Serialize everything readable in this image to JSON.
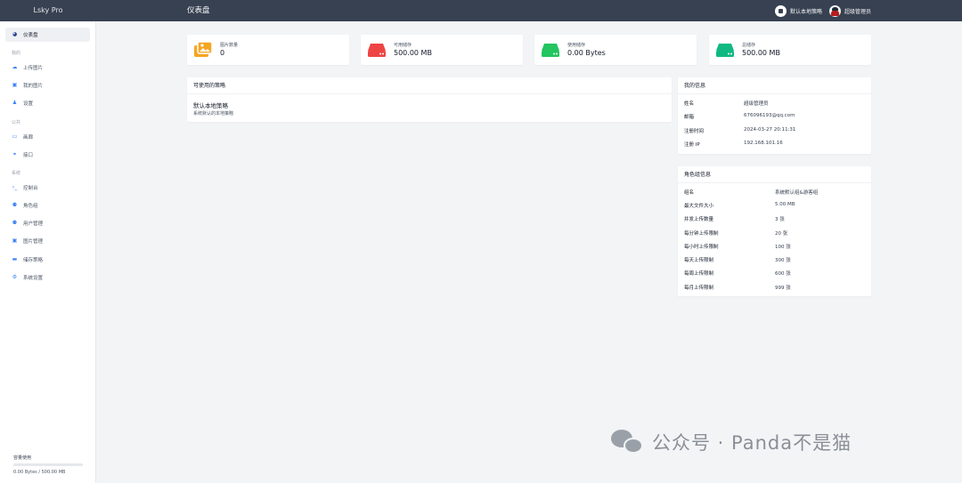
{
  "app": {
    "brand": "Lsky Pro",
    "page_title": "仪表盘"
  },
  "topbar": {
    "strategy_button": "默认本地策略",
    "user_button": "超级管理员"
  },
  "sidebar": {
    "items": [
      {
        "label": "仪表盘",
        "icon": "dashboard-icon"
      },
      {
        "label": "上传图片",
        "icon": "cloud-upload-icon"
      },
      {
        "label": "我的图片",
        "icon": "images-icon"
      },
      {
        "label": "设置",
        "icon": "user-cog-icon"
      },
      {
        "label": "画廊",
        "icon": "monitor-icon"
      },
      {
        "label": "接口",
        "icon": "link-icon"
      },
      {
        "label": "控制台",
        "icon": "terminal-icon"
      },
      {
        "label": "角色组",
        "icon": "users-icon"
      },
      {
        "label": "用户管理",
        "icon": "users-icon"
      },
      {
        "label": "图片管理",
        "icon": "images-icon"
      },
      {
        "label": "储存策略",
        "icon": "hdd-icon"
      },
      {
        "label": "系统设置",
        "icon": "gears-icon"
      }
    ],
    "sections": [
      "我的",
      "公共",
      "系统"
    ],
    "usage": {
      "label": "容量使用",
      "text": "0.00 Bytes / 500.00 MB",
      "fraction": 0
    }
  },
  "stats": [
    {
      "label": "图片数量",
      "value": "0",
      "icon": "images-icon",
      "color": "#f5a623"
    },
    {
      "label": "可用储存",
      "value": "500.00 MB",
      "icon": "hdd-icon",
      "color": "#ef4444"
    },
    {
      "label": "使用储存",
      "value": "0.00 Bytes",
      "icon": "hdd-icon",
      "color": "#22c55e"
    },
    {
      "label": "总储存",
      "value": "500.00 MB",
      "icon": "hdd-icon",
      "color": "#10b981"
    }
  ],
  "strategies": {
    "title": "可使用的策略",
    "name": "默认本地策略",
    "description": "系统默认的本地策略"
  },
  "my_info": {
    "title": "我的信息",
    "rows": [
      {
        "key": "姓名",
        "value": "超级管理员"
      },
      {
        "key": "邮箱",
        "value": "676096193@qq.com"
      },
      {
        "key": "注册时间",
        "value": "2024-03-27 20:11:31"
      },
      {
        "key": "注册 IP",
        "value": "192.168.101.16"
      }
    ]
  },
  "role_info": {
    "title": "角色组信息",
    "rows": [
      {
        "key": "组名",
        "value": "系统默认组&游客组"
      },
      {
        "key": "最大文件大小",
        "value": "5.00 MB"
      },
      {
        "key": "并发上传数量",
        "value": "3 张"
      },
      {
        "key": "每分钟上传限制",
        "value": "20 张"
      },
      {
        "key": "每小时上传限制",
        "value": "100 张"
      },
      {
        "key": "每天上传限制",
        "value": "300 张"
      },
      {
        "key": "每周上传限制",
        "value": "600 张"
      },
      {
        "key": "每月上传限制",
        "value": "999 张"
      }
    ]
  },
  "watermark": {
    "text": "公众号 · Panda不是猫"
  }
}
